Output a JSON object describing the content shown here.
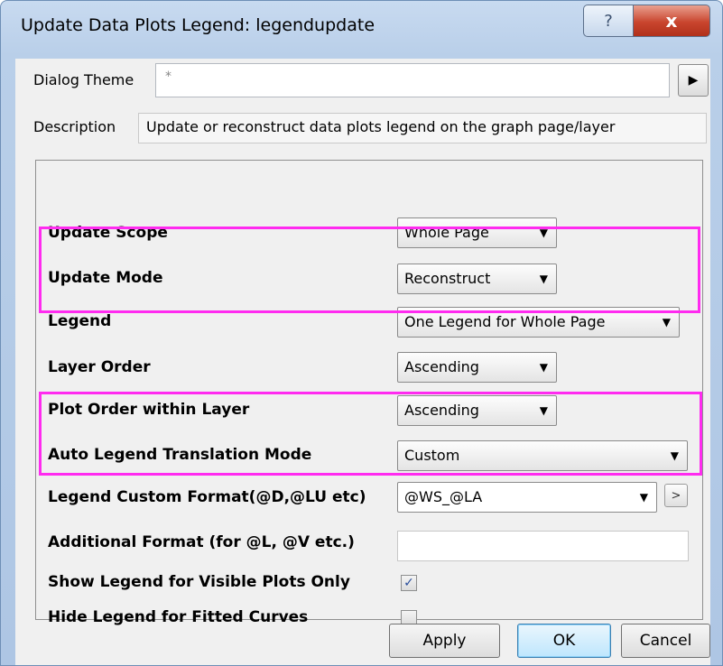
{
  "window": {
    "title": "Update Data Plots Legend: legendupdate",
    "help_glyph": "?",
    "close_glyph": "x"
  },
  "dialog_theme": {
    "label": "Dialog Theme",
    "value": "*",
    "arrow_glyph": "▶"
  },
  "description": {
    "label": "Description",
    "value": "Update or reconstruct data plots legend on the graph page/layer"
  },
  "settings": {
    "update_scope": {
      "label": "Update Scope",
      "value": "Whole Page"
    },
    "update_mode": {
      "label": "Update Mode",
      "value": "Reconstruct"
    },
    "legend": {
      "label": "Legend",
      "value": "One Legend for Whole Page"
    },
    "layer_order": {
      "label": "Layer Order",
      "value": "Ascending"
    },
    "plot_order": {
      "label": "Plot Order within Layer",
      "value": "Ascending"
    },
    "auto_translation": {
      "label": "Auto Legend Translation Mode",
      "value": "Custom"
    },
    "custom_format": {
      "label": "Legend Custom Format(@D,@LU etc)",
      "value": "@WS_@LA",
      "more_glyph": ">"
    },
    "additional_format": {
      "label": "Additional Format (for @L, @V etc.)",
      "value": ""
    },
    "show_visible_only": {
      "label": "Show Legend for Visible Plots Only",
      "checked": true,
      "check_glyph": "✓"
    },
    "hide_fitted": {
      "label": "Hide Legend for Fitted Curves",
      "checked": false
    }
  },
  "caret_glyph": "▼",
  "buttons": {
    "apply": "Apply",
    "ok": "OK",
    "cancel": "Cancel"
  },
  "colors": {
    "highlight": "#ff2bf0",
    "check": "#2b4f9c"
  }
}
